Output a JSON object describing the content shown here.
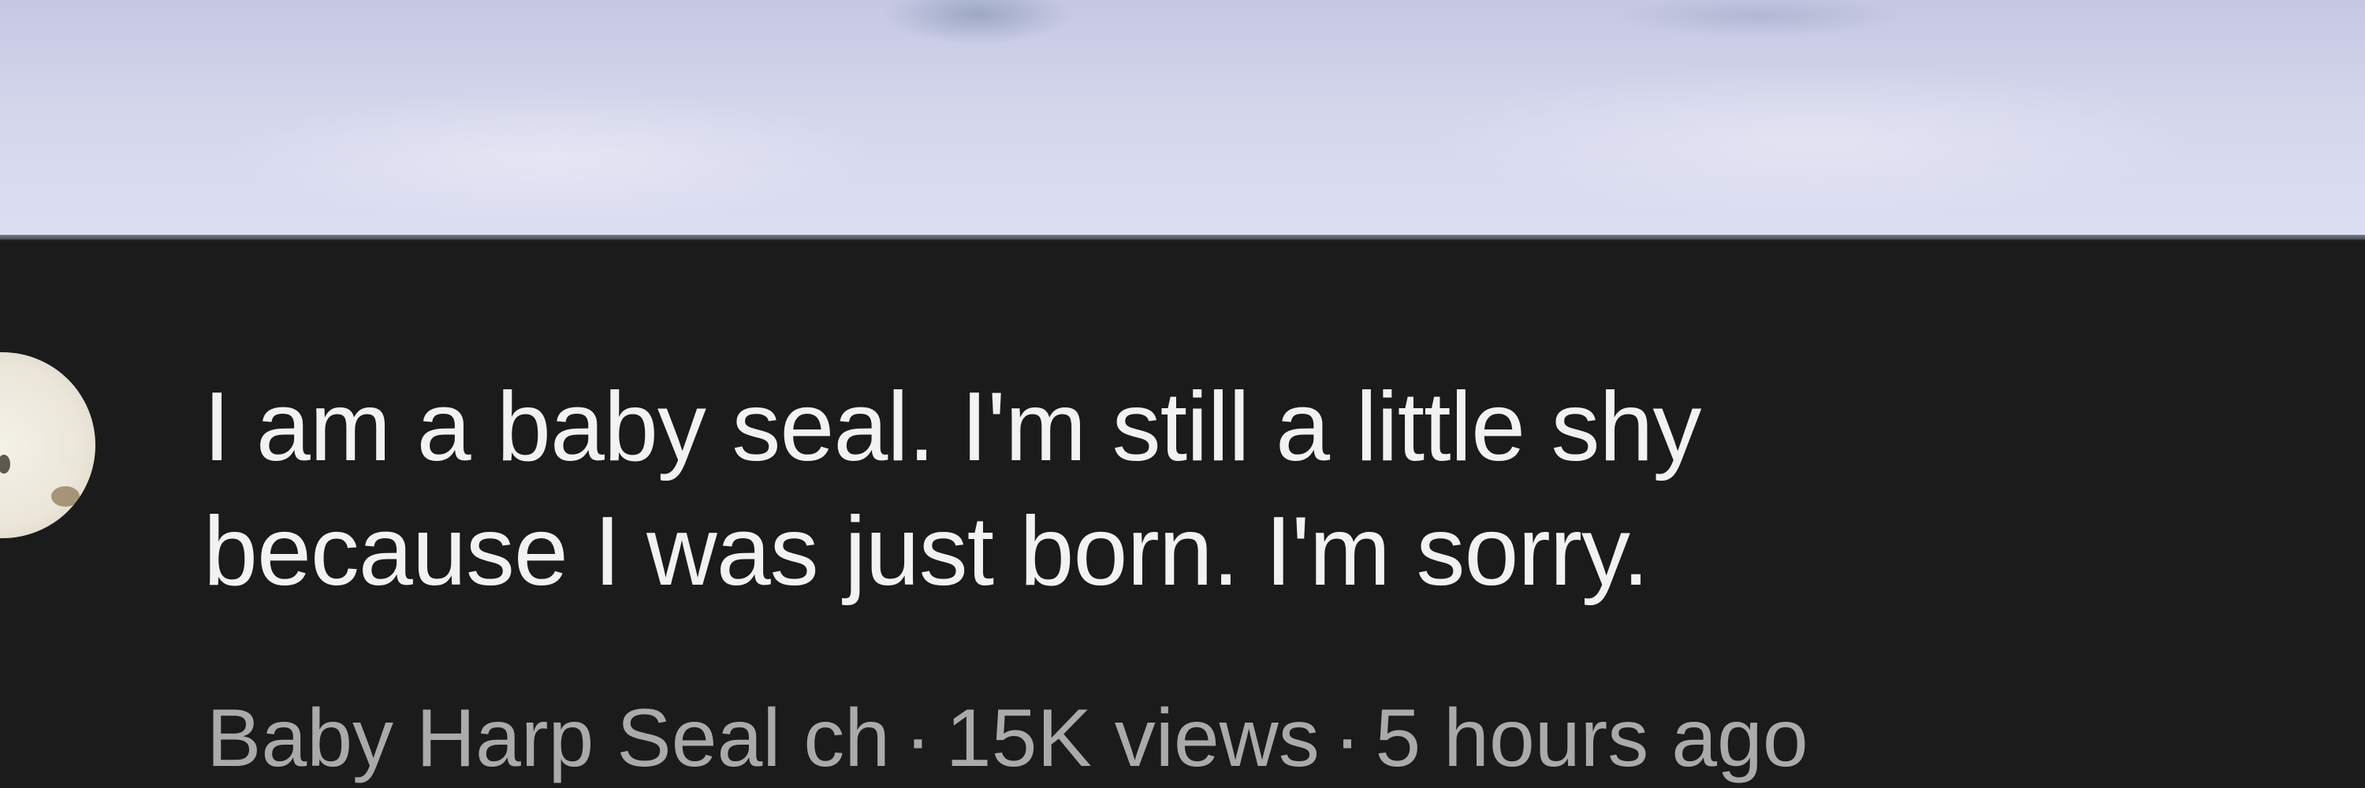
{
  "video": {
    "title_line1": "I am a baby seal. I'm still a little shy",
    "title_line2": "because I was just born. I'm sorry.",
    "channel": "Baby Harp Seal ch",
    "views": "15K views",
    "age": "5 hours ago",
    "separator": "·"
  },
  "colors": {
    "background": "#181818",
    "title_text": "#f2f2f2",
    "meta_text": "#aaaaaa",
    "thumbnail_sky": "#d4d6ec"
  },
  "icons": {
    "avatar": "channel-avatar (baby seal photo)"
  }
}
